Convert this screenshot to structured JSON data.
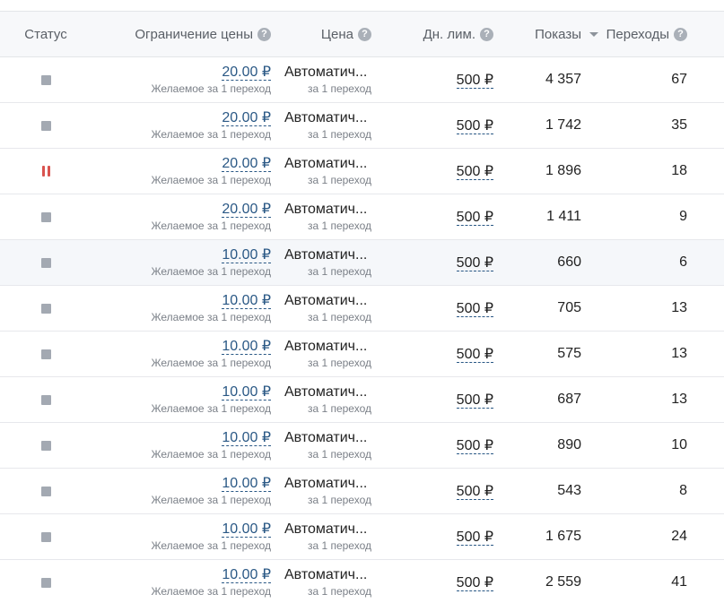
{
  "header": {
    "status": "Статус",
    "limit": "Ограничение цены",
    "price": "Цена",
    "daily": "Дн. лим.",
    "shows": "Показы",
    "clicks": "Переходы",
    "help_glyph": "?"
  },
  "rows": [
    {
      "status": "stopped",
      "limit": "20.00 ₽",
      "limit_sub": "Желаемое за 1 переход",
      "price": "Автоматич...",
      "price_sub": "за 1 переход",
      "daily": "500 ₽",
      "shows": "4 357",
      "clicks": "67"
    },
    {
      "status": "stopped",
      "limit": "20.00 ₽",
      "limit_sub": "Желаемое за 1 переход",
      "price": "Автоматич...",
      "price_sub": "за 1 переход",
      "daily": "500 ₽",
      "shows": "1 742",
      "clicks": "35"
    },
    {
      "status": "paused",
      "limit": "20.00 ₽",
      "limit_sub": "Желаемое за 1 переход",
      "price": "Автоматич...",
      "price_sub": "за 1 переход",
      "daily": "500 ₽",
      "shows": "1 896",
      "clicks": "18"
    },
    {
      "status": "stopped",
      "limit": "20.00 ₽",
      "limit_sub": "Желаемое за 1 переход",
      "price": "Автоматич...",
      "price_sub": "за 1 переход",
      "daily": "500 ₽",
      "shows": "1 411",
      "clicks": "9"
    },
    {
      "status": "stopped",
      "limit": "10.00 ₽",
      "limit_sub": "Желаемое за 1 переход",
      "price": "Автоматич...",
      "price_sub": "за 1 переход",
      "daily": "500 ₽",
      "shows": "660",
      "clicks": "6"
    },
    {
      "status": "stopped",
      "limit": "10.00 ₽",
      "limit_sub": "Желаемое за 1 переход",
      "price": "Автоматич...",
      "price_sub": "за 1 переход",
      "daily": "500 ₽",
      "shows": "705",
      "clicks": "13"
    },
    {
      "status": "stopped",
      "limit": "10.00 ₽",
      "limit_sub": "Желаемое за 1 переход",
      "price": "Автоматич...",
      "price_sub": "за 1 переход",
      "daily": "500 ₽",
      "shows": "575",
      "clicks": "13"
    },
    {
      "status": "stopped",
      "limit": "10.00 ₽",
      "limit_sub": "Желаемое за 1 переход",
      "price": "Автоматич...",
      "price_sub": "за 1 переход",
      "daily": "500 ₽",
      "shows": "687",
      "clicks": "13"
    },
    {
      "status": "stopped",
      "limit": "10.00 ₽",
      "limit_sub": "Желаемое за 1 переход",
      "price": "Автоматич...",
      "price_sub": "за 1 переход",
      "daily": "500 ₽",
      "shows": "890",
      "clicks": "10"
    },
    {
      "status": "stopped",
      "limit": "10.00 ₽",
      "limit_sub": "Желаемое за 1 переход",
      "price": "Автоматич...",
      "price_sub": "за 1 переход",
      "daily": "500 ₽",
      "shows": "543",
      "clicks": "8"
    },
    {
      "status": "stopped",
      "limit": "10.00 ₽",
      "limit_sub": "Желаемое за 1 переход",
      "price": "Автоматич...",
      "price_sub": "за 1 переход",
      "daily": "500 ₽",
      "shows": "1 675",
      "clicks": "24"
    },
    {
      "status": "stopped",
      "limit": "10.00 ₽",
      "limit_sub": "Желаемое за 1 переход",
      "price": "Автоматич...",
      "price_sub": "за 1 переход",
      "daily": "500 ₽",
      "shows": "2 559",
      "clicks": "41"
    }
  ],
  "icons": {
    "help": "question-circle-icon",
    "sort": "sort-desc-icon",
    "stopped": "stop-square-icon",
    "paused": "pause-icon"
  },
  "colors": {
    "link": "#2a5885",
    "paused": "#d9534f",
    "stopped": "#a3a9b2",
    "header_bg": "#f7f8fa"
  }
}
